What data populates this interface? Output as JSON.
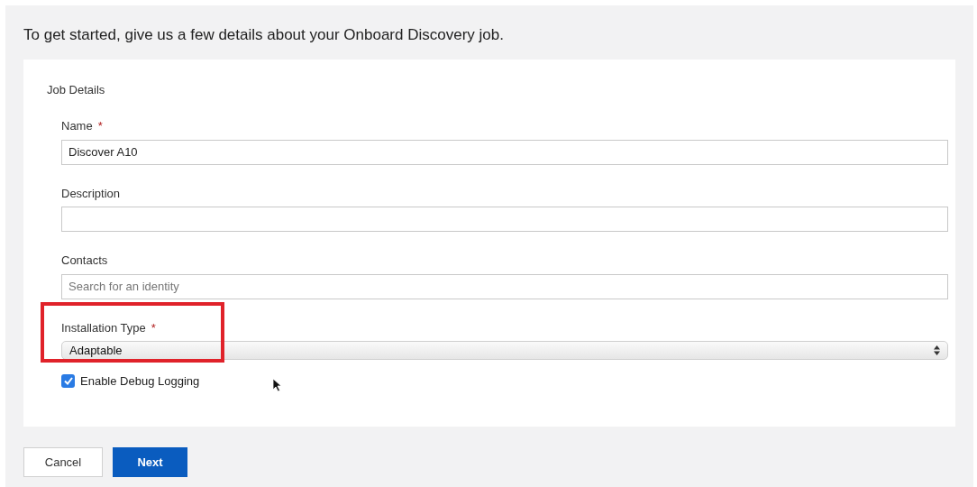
{
  "intro": "To get started, give us a few details about your Onboard Discovery job.",
  "section": {
    "title": "Job Details"
  },
  "fields": [
    {
      "kind": "text",
      "label": "Name",
      "required": true,
      "value": "Discover A10"
    },
    {
      "kind": "text",
      "label": "Description",
      "required": false
    },
    {
      "kind": "text",
      "label": "Contacts",
      "required": false,
      "placeholder": "Search for an identity"
    },
    {
      "kind": "select",
      "label": "Installation Type",
      "required": true,
      "value": "Adaptable",
      "highlighted": true
    }
  ],
  "required_mark": "*",
  "debug_logging": {
    "label": "Enable Debug Logging",
    "checked": true
  },
  "buttons": [
    {
      "label": "Cancel",
      "kind": "secondary"
    },
    {
      "label": "Next",
      "kind": "primary"
    }
  ]
}
